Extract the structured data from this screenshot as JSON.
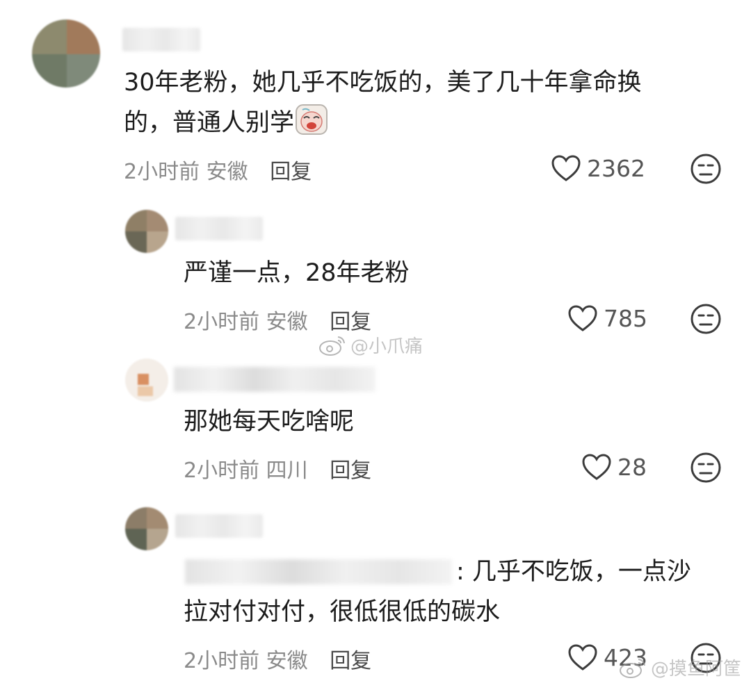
{
  "comments": [
    {
      "text_lines": [
        "30年老粉，她几乎不吃饭的，美了几十年拿命换",
        "的，普通人别学"
      ],
      "time": "2小时前",
      "location": "安徽",
      "reply_label": "回复",
      "likes": "2362"
    },
    {
      "text_lines": [
        "严谨一点，28年老粉"
      ],
      "time": "2小时前",
      "location": "安徽",
      "reply_label": "回复",
      "likes": "785"
    },
    {
      "text_lines": [
        "那她每天吃啥呢"
      ],
      "time": "2小时前",
      "location": "四川",
      "reply_label": "回复",
      "likes": "28"
    },
    {
      "text_lines": [
        ": 几乎不吃饭，一点沙",
        "拉对付对付，很低很低的碳水"
      ],
      "time": "2小时前",
      "location": "安徽",
      "reply_label": "回复",
      "likes": "423"
    }
  ],
  "watermarks": [
    "@小爪痛",
    "@摸鱼阿筐"
  ],
  "icons": {
    "like": "heart-outline-icon",
    "dislike": "unamused-face-icon",
    "emoji": "crying-face-emoji"
  },
  "colors": {
    "text": "#1c1c1c",
    "meta": "#8a8a8a",
    "reply": "#4a4a4a",
    "icon": "#3c3c3c"
  }
}
